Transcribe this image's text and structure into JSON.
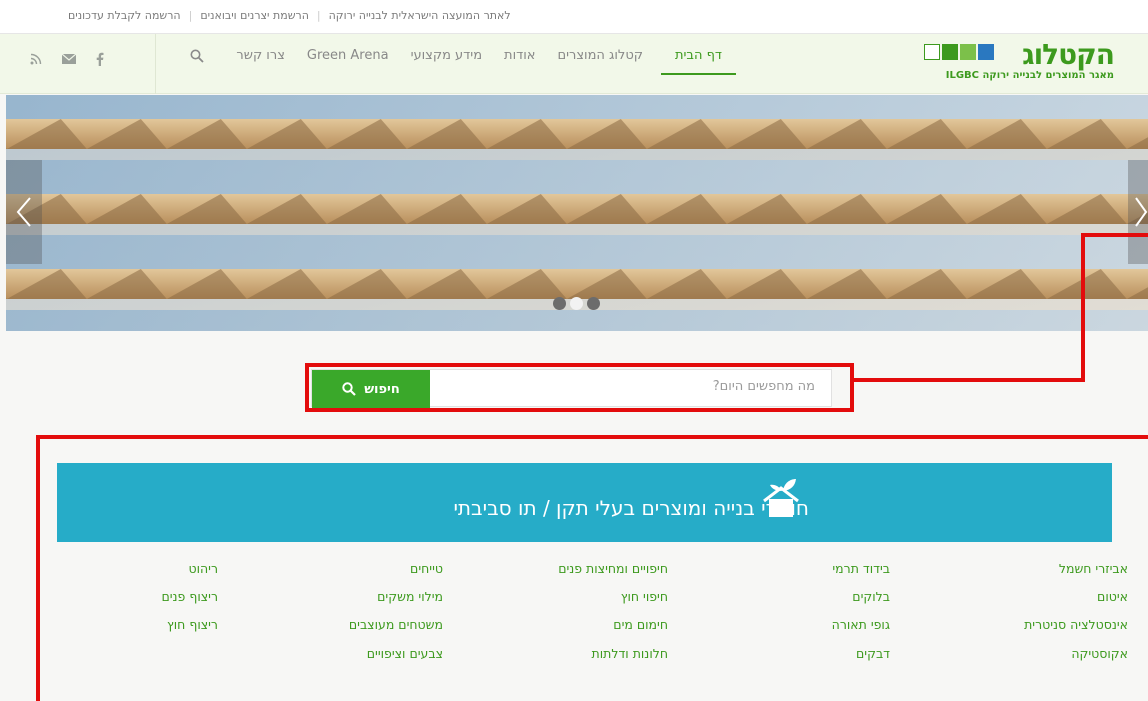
{
  "topbar": {
    "links": [
      "לאתר המועצה הישראלית לבנייה ירוקה",
      "הרשמת יצרנים ויבואנים",
      "הרשמה לקבלת עדכונים"
    ]
  },
  "logo": {
    "wordmark": "הקטלוג",
    "subtitle": "מאגר המוצרים לבנייה ירוקה ILGBC"
  },
  "nav": {
    "items": [
      "דף הבית",
      "קטלוג המוצרים",
      "אודות",
      "מידע מקצועי",
      "Green Arena",
      "צרו קשר"
    ],
    "active_index": 0
  },
  "social_icons": [
    "rss-icon",
    "email-icon",
    "facebook-icon"
  ],
  "hero": {
    "slides": 3,
    "active_slide": 1
  },
  "search": {
    "placeholder": "מה מחפשים היום?",
    "button_label": "חיפוש"
  },
  "category_panel": {
    "title": "חומרי בנייה ומוצרים בעלי תקן / תו סביבתי",
    "columns": [
      [
        "אביזרי חשמל",
        "איטום",
        "אינסטלציה סניטרית",
        "אקוסטיקה"
      ],
      [
        "בידוד תרמי",
        "בלוקים",
        "גופי תאורה",
        "דבקים"
      ],
      [
        "חיפויים ומחיצות פנים",
        "חיפוי חוץ",
        "חימום מים",
        "חלונות ודלתות"
      ],
      [
        "טייחים",
        "מילוי משקים",
        "משטחים מעוצבים",
        "צבעים וציפויים"
      ],
      [
        "ריהוט",
        "ריצוף פנים",
        "ריצוף חוץ"
      ]
    ]
  },
  "colors": {
    "brand_green": "#3d9a1e",
    "button_green": "#3aa82a",
    "panel_blue": "#26acc8",
    "highlight_red": "#e30c0c"
  }
}
